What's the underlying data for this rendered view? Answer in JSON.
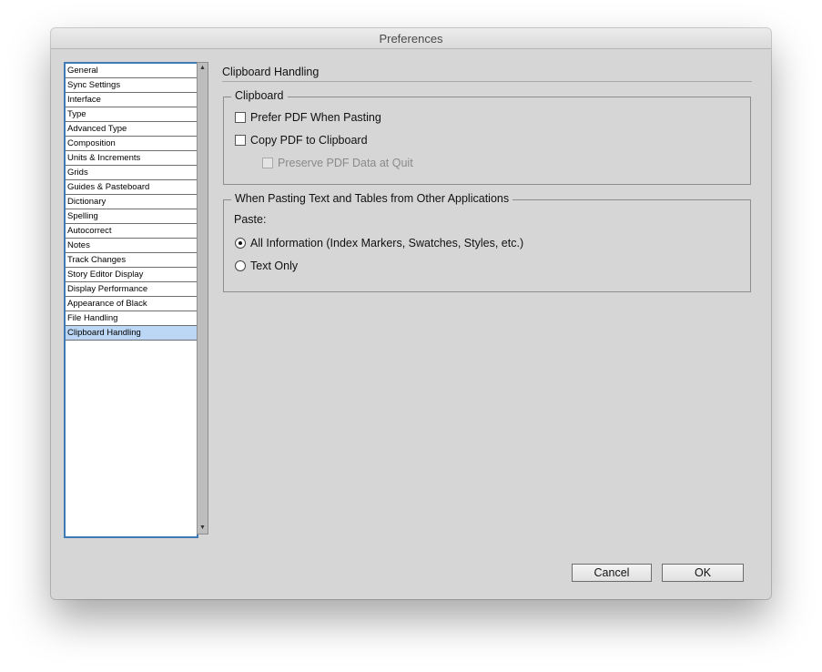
{
  "window": {
    "title": "Preferences"
  },
  "sidebar": {
    "items": [
      {
        "label": "General"
      },
      {
        "label": "Sync Settings"
      },
      {
        "label": "Interface"
      },
      {
        "label": "Type"
      },
      {
        "label": "Advanced Type"
      },
      {
        "label": "Composition"
      },
      {
        "label": "Units & Increments"
      },
      {
        "label": "Grids"
      },
      {
        "label": "Guides & Pasteboard"
      },
      {
        "label": "Dictionary"
      },
      {
        "label": "Spelling"
      },
      {
        "label": "Autocorrect"
      },
      {
        "label": "Notes"
      },
      {
        "label": "Track Changes"
      },
      {
        "label": "Story Editor Display"
      },
      {
        "label": "Display Performance"
      },
      {
        "label": "Appearance of Black"
      },
      {
        "label": "File Handling"
      },
      {
        "label": "Clipboard Handling"
      }
    ],
    "selected_label": "Clipboard Handling"
  },
  "main": {
    "section_title": "Clipboard Handling",
    "clipboard_group": {
      "legend": "Clipboard",
      "prefer_pdf": {
        "label": "Prefer PDF When Pasting",
        "checked": false
      },
      "copy_pdf": {
        "label": "Copy PDF to Clipboard",
        "checked": false
      },
      "preserve_pdf": {
        "label": "Preserve PDF Data at Quit",
        "checked": false,
        "enabled": false
      }
    },
    "pasting_group": {
      "legend": "When Pasting Text and Tables from Other Applications",
      "paste_label": "Paste:",
      "all_info": {
        "label": "All Information (Index Markers, Swatches, Styles, etc.)",
        "selected": true
      },
      "text_only": {
        "label": "Text Only",
        "selected": false
      }
    }
  },
  "buttons": {
    "cancel_label": "Cancel",
    "ok_label": "OK"
  },
  "icons": {
    "scroll_up": "▲",
    "scroll_down": "▼"
  },
  "colors": {
    "selection_highlight": "#bcd7f5",
    "list_border": "#3f7ab4",
    "dialog_background": "#d6d6d6"
  }
}
